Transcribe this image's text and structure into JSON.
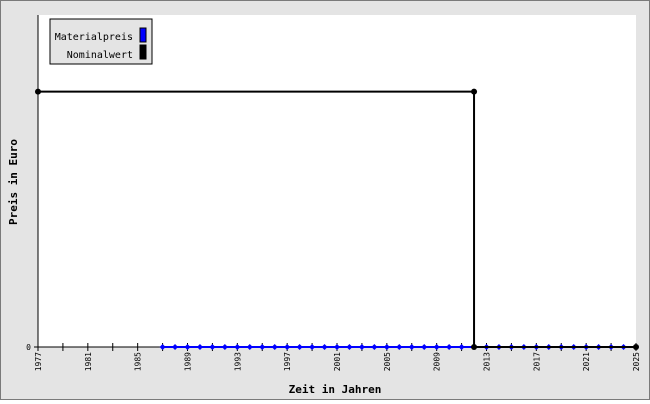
{
  "chart_data": {
    "type": "line",
    "title": "",
    "xlabel": "Zeit in Jahren",
    "ylabel": "Preis in Euro",
    "xlim": [
      1977,
      2025
    ],
    "x_ticks": [
      1977,
      1981,
      1985,
      1989,
      1993,
      1997,
      2001,
      2005,
      2009,
      2013,
      2017,
      2021,
      2025
    ],
    "y_ticks": [
      0
    ],
    "legend_position": "top-left",
    "grid": false,
    "series": [
      {
        "name": "Materialpreis",
        "color": "#0000ff",
        "x": [
          1987,
          1988,
          1989,
          1990,
          1991,
          1992,
          1993,
          1994,
          1995,
          1996,
          1997,
          1998,
          1999,
          2000,
          2001,
          2002,
          2003,
          2004,
          2005,
          2006,
          2007,
          2008,
          2009,
          2010,
          2011,
          2012,
          2013,
          2014,
          2015,
          2016,
          2017,
          2018,
          2019,
          2020,
          2021,
          2022,
          2023,
          2024,
          2025
        ],
        "y": [
          0,
          0,
          0,
          0,
          0,
          0,
          0,
          0,
          0,
          0,
          0,
          0,
          0,
          0,
          0,
          0,
          0,
          0,
          0,
          0,
          0,
          0,
          0,
          0,
          0,
          0,
          0,
          0,
          0,
          0,
          0,
          0,
          0,
          0,
          0,
          0,
          0,
          0,
          0
        ]
      },
      {
        "name": "Nominalwert",
        "color": "#000000",
        "x": [
          1977,
          2012,
          2012,
          2025
        ],
        "y": [
          1,
          1,
          0,
          0
        ],
        "marker_indices": [
          0,
          1,
          2,
          3
        ]
      }
    ]
  }
}
